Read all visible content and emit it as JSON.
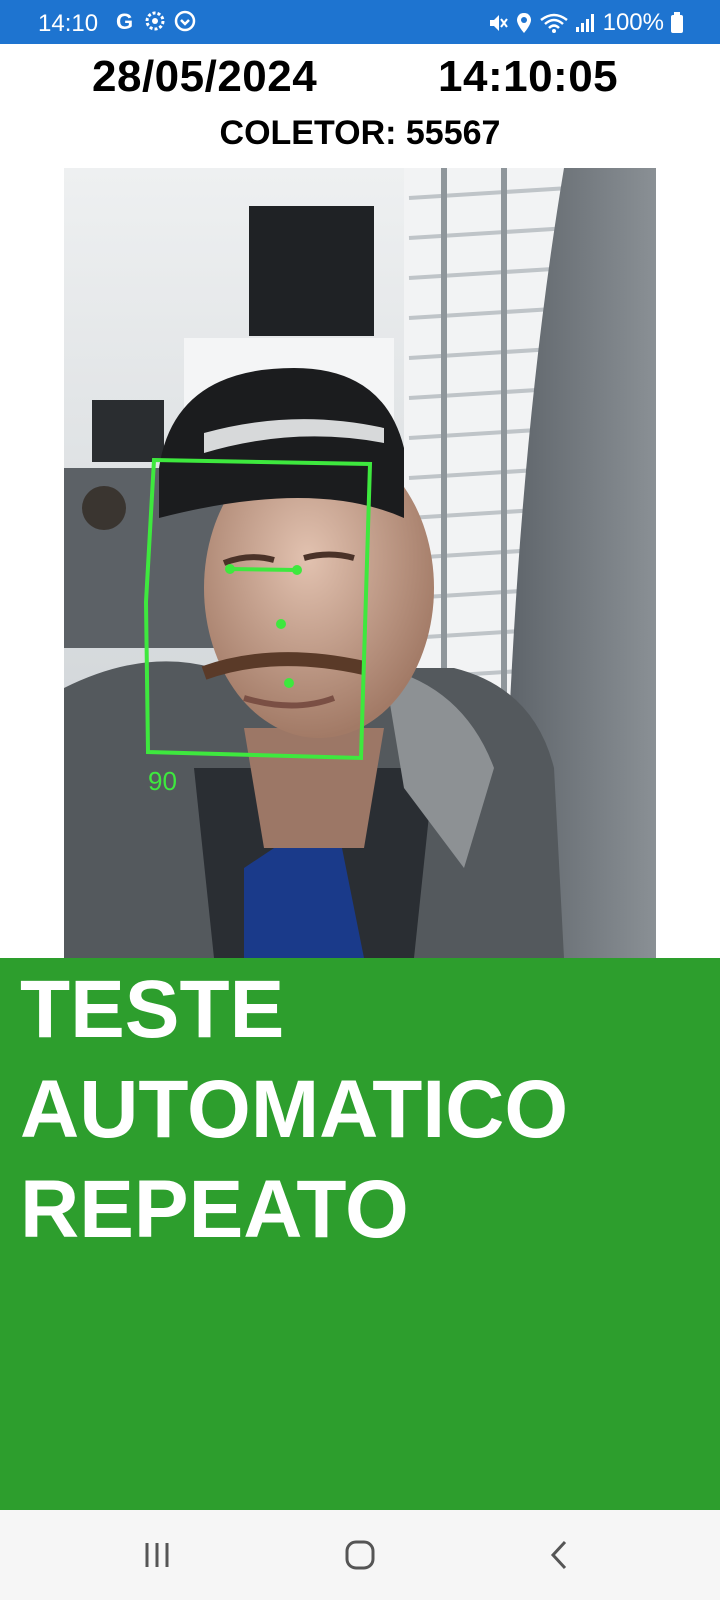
{
  "status_bar": {
    "time": "14:10",
    "icons_left": [
      "google-icon",
      "settings-gear-icon",
      "app-notification-icon"
    ],
    "icons_right": [
      "mute-vibrate-icon",
      "location-icon",
      "wifi-icon",
      "signal-icon",
      "battery-icon"
    ],
    "battery": "100%",
    "background": "#1e74d0"
  },
  "header": {
    "date": "28/05/2024",
    "time": "14:10:05",
    "collector": "COLETOR: 55567"
  },
  "camera": {
    "face_score": "90",
    "detection_color": "#3ee83e"
  },
  "result": {
    "lines": [
      "TESTE",
      "AUTOMATICO",
      "REPEATO"
    ],
    "background": "#2d9e2d"
  },
  "nav_bar": {
    "buttons": [
      "recent-apps-icon",
      "home-icon",
      "back-icon"
    ]
  }
}
